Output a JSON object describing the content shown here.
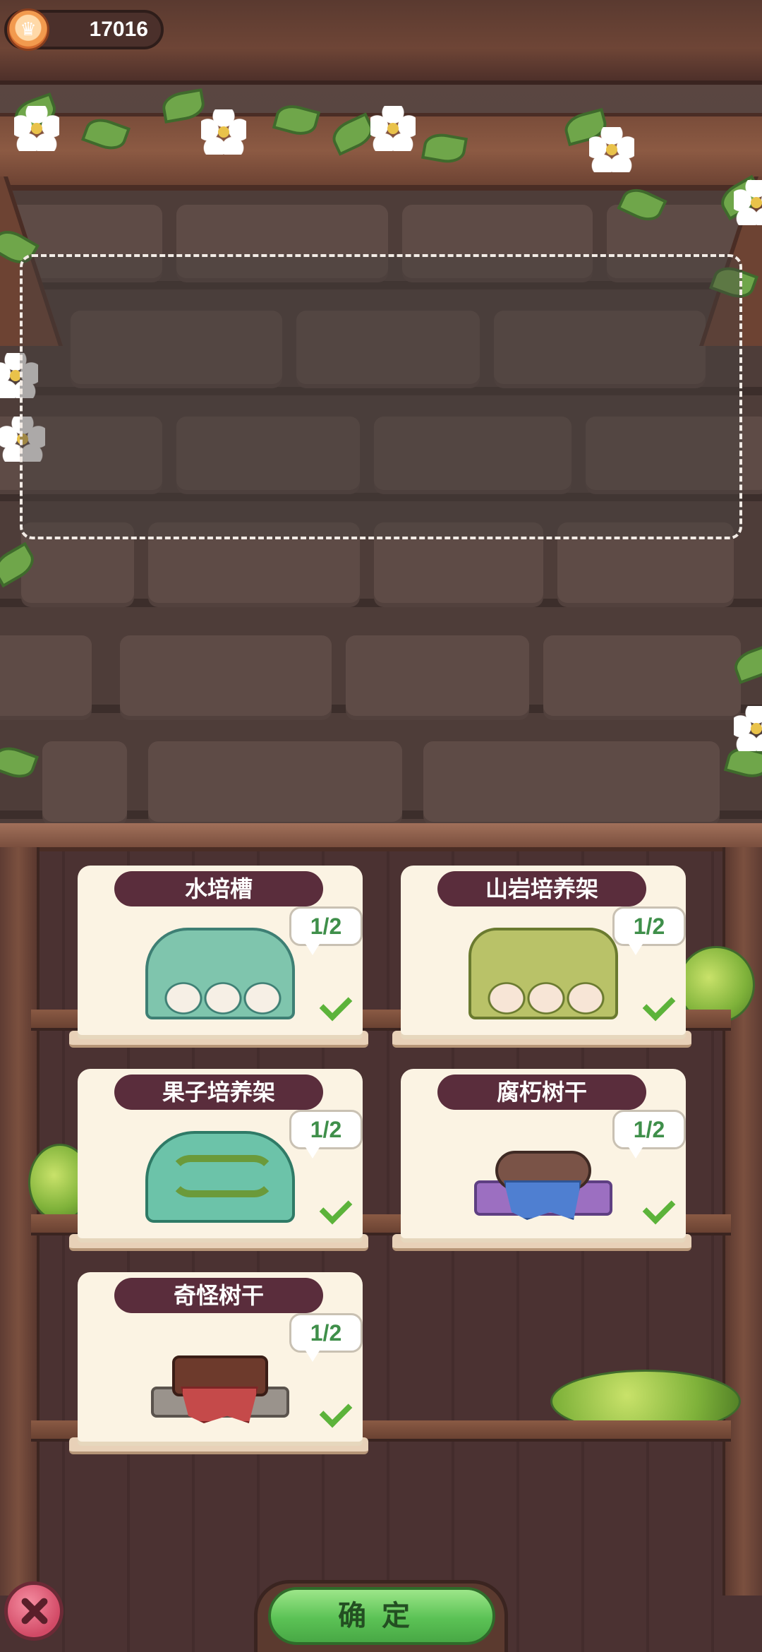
{
  "currency": {
    "icon": "crown-coin-icon",
    "value": "17016"
  },
  "placement_area": {
    "label": ""
  },
  "items": [
    {
      "name": "水培槽",
      "count": "1/2",
      "art": "hydroponic-tank",
      "completed": true
    },
    {
      "name": "山岩培养架",
      "count": "1/2",
      "art": "rock-culture-rack",
      "completed": true
    },
    {
      "name": "果子培养架",
      "count": "1/2",
      "art": "fruit-culture-rack",
      "completed": true
    },
    {
      "name": "腐朽树干",
      "count": "1/2",
      "art": "rotten-trunk",
      "completed": true
    },
    {
      "name": "奇怪树干",
      "count": "1/2",
      "art": "strange-trunk",
      "completed": true
    }
  ],
  "buttons": {
    "confirm_label": "确定",
    "close_icon": "close-icon"
  },
  "colors": {
    "title_bg": "#5a2d3c",
    "count_text": "#3f8f4a",
    "confirm_green": "#5bc255",
    "close_pink": "#d24a66"
  }
}
